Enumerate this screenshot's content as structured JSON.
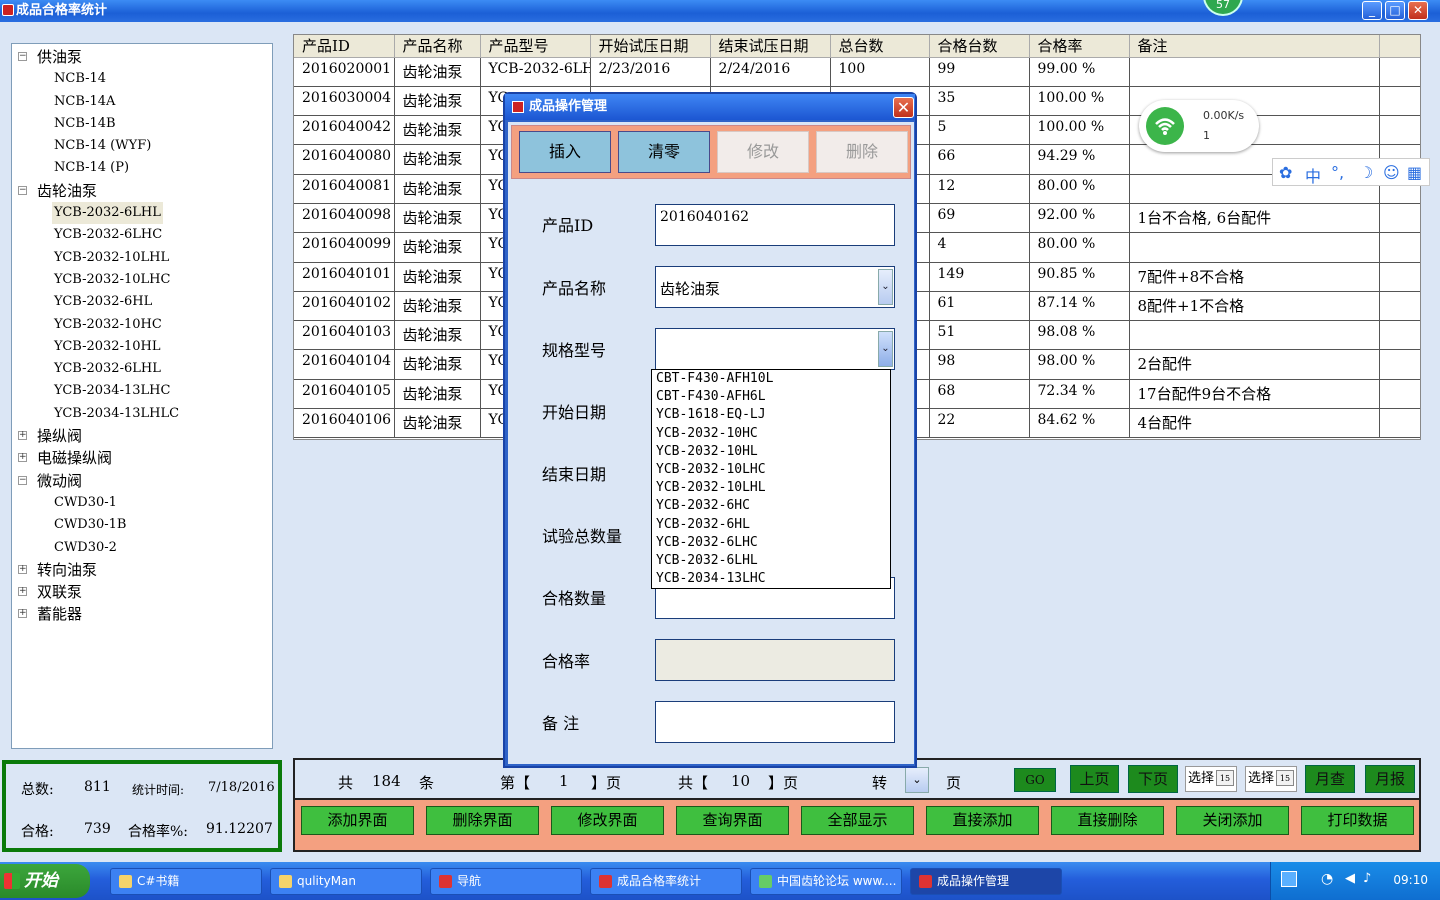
{
  "window": {
    "title": "成品合格率统计",
    "badge": "57",
    "min": "_",
    "max": "□",
    "close": "✕"
  },
  "tree": [
    {
      "label": "供油泵",
      "toggle": "−",
      "level": 0
    },
    {
      "label": "NCB-14",
      "level": 1
    },
    {
      "label": "NCB-14A",
      "level": 1
    },
    {
      "label": "NCB-14B",
      "level": 1
    },
    {
      "label": "NCB-14 (WYF)",
      "level": 1
    },
    {
      "label": "NCB-14 (P)",
      "level": 1
    },
    {
      "label": "齿轮油泵",
      "toggle": "−",
      "level": 0
    },
    {
      "label": "YCB-2032-6LHL",
      "level": 1,
      "selected": true
    },
    {
      "label": "YCB-2032-6LHC",
      "level": 1
    },
    {
      "label": "YCB-2032-10LHL",
      "level": 1
    },
    {
      "label": "YCB-2032-10LHC",
      "level": 1
    },
    {
      "label": "YCB-2032-6HL",
      "level": 1
    },
    {
      "label": "YCB-2032-10HC",
      "level": 1
    },
    {
      "label": "YCB-2032-10HL",
      "level": 1
    },
    {
      "label": "YCB-2032-6LHL",
      "level": 1
    },
    {
      "label": "YCB-2034-13LHC",
      "level": 1
    },
    {
      "label": "YCB-2034-13LHLC",
      "level": 1
    },
    {
      "label": "操纵阀",
      "toggle": "+",
      "level": 0
    },
    {
      "label": "电磁操纵阀",
      "toggle": "+",
      "level": 0
    },
    {
      "label": "微动阀",
      "toggle": "−",
      "level": 0
    },
    {
      "label": "CWD30-1",
      "level": 1
    },
    {
      "label": "CWD30-1B",
      "level": 1
    },
    {
      "label": "CWD30-2",
      "level": 1
    },
    {
      "label": "转向油泵",
      "toggle": "+",
      "level": 0
    },
    {
      "label": "双联泵",
      "toggle": "+",
      "level": 0
    },
    {
      "label": "蓄能器",
      "toggle": "+",
      "level": 0
    }
  ],
  "stats": {
    "total_label": "总数:",
    "total_value": "811",
    "time_label": "统计时间:",
    "time_value": "7/18/2016",
    "pass_label": "合格:",
    "pass_value": "739",
    "rate_label": "合格率%:",
    "rate_value": "91.12207"
  },
  "grid": {
    "columns": [
      "产品ID",
      "产品名称",
      "产品型号",
      "开始试压日期",
      "结束试压日期",
      "总台数",
      "合格台数",
      "合格率",
      "备注"
    ],
    "rows": [
      [
        "2016020001",
        "齿轮油泵",
        "YCB-2032-6LHL",
        "2/23/2016",
        "2/24/2016",
        "100",
        "99",
        "99.00 %",
        ""
      ],
      [
        "2016030004",
        "齿轮油泵",
        "YC",
        "",
        "",
        "",
        "35",
        "100.00 %",
        ""
      ],
      [
        "2016040042",
        "齿轮油泵",
        "YC",
        "",
        "",
        "",
        "5",
        "100.00 %",
        ""
      ],
      [
        "2016040080",
        "齿轮油泵",
        "YC",
        "",
        "",
        "",
        "66",
        "94.29 %",
        ""
      ],
      [
        "2016040081",
        "齿轮油泵",
        "YC",
        "",
        "",
        "",
        "12",
        "80.00 %",
        ""
      ],
      [
        "2016040098",
        "齿轮油泵",
        "YC",
        "",
        "",
        "",
        "69",
        "92.00 %",
        "1台不合格, 6台配件"
      ],
      [
        "2016040099",
        "齿轮油泵",
        "YC",
        "",
        "",
        "",
        "4",
        "80.00 %",
        ""
      ],
      [
        "2016040101",
        "齿轮油泵",
        "YC",
        "",
        "",
        "",
        "149",
        "90.85 %",
        "7配件+8不合格"
      ],
      [
        "2016040102",
        "齿轮油泵",
        "YC",
        "",
        "",
        "",
        "61",
        "87.14 %",
        "8配件+1不合格"
      ],
      [
        "2016040103",
        "齿轮油泵",
        "YC",
        "",
        "",
        "",
        "51",
        "98.08 %",
        ""
      ],
      [
        "2016040104",
        "齿轮油泵",
        "YC",
        "",
        "",
        "",
        "98",
        "98.00 %",
        "2台配件"
      ],
      [
        "2016040105",
        "齿轮油泵",
        "YC",
        "",
        "",
        "",
        "68",
        "72.34 %",
        "17台配件9台不合格"
      ],
      [
        "2016040106",
        "齿轮油泵",
        "YC",
        "",
        "",
        "",
        "22",
        "84.62 %",
        "4台配件"
      ]
    ]
  },
  "pager": {
    "total_prefix": "共",
    "total_records": "184",
    "total_unit": "条",
    "page_prefix": "第【",
    "current_page": "1",
    "page_suffix": "】页",
    "pages_prefix": "共【",
    "total_pages": "10",
    "pages_suffix": "】页",
    "goto_label": "转",
    "goto_unit": "页",
    "go_btn": "GO",
    "prev_btn": "上页",
    "next_btn": "下页",
    "date1": "选择",
    "date2": "选择",
    "cal_num": "15",
    "month_query_btn": "月查",
    "month_report_btn": "月报"
  },
  "actions": [
    "添加界面",
    "删除界面",
    "修改界面",
    "查询界面",
    "全部显示",
    "直接添加",
    "直接删除",
    "关闭添加",
    "打印数据"
  ],
  "dialog": {
    "title": "成品操作管理",
    "close": "✕",
    "buttons": {
      "insert": "插入",
      "clear": "清零",
      "modify": "修改",
      "delete": "删除"
    },
    "fields": {
      "product_id_label": "产品ID",
      "product_id_value": "2016040162",
      "product_name_label": "产品名称",
      "product_name_value": "齿轮油泵",
      "spec_label": "规格型号",
      "spec_value": "",
      "start_label": "开始日期",
      "end_label": "结束日期",
      "total_label": "试验总数量",
      "pass_label": "合格数量",
      "rate_label": "合格率",
      "note_label": "备 注"
    },
    "dropdown_arrow": "⌄",
    "dropdown_options": [
      "CBT-F430-AFH10L",
      "CBT-F430-AFH6L",
      "YCB-1618-EQ-LJ",
      "YCB-2032-10HC",
      "YCB-2032-10HL",
      "YCB-2032-10LHC",
      "YCB-2032-10LHL",
      "YCB-2032-6HC",
      "YCB-2032-6HL",
      "YCB-2032-6LHC",
      "YCB-2032-6LHL",
      "YCB-2034-13LHC"
    ]
  },
  "wifi": {
    "speed": "0.00K/s",
    "count": "1"
  },
  "ime": {
    "chinese": "中",
    "punct": "°,",
    "moon": "☽",
    "user": "☺",
    "grid": "▦",
    "paw": "✿"
  },
  "taskbar": {
    "start": "开始",
    "tasks": [
      {
        "label": "C#书籍",
        "icon_color": "#f5d36b"
      },
      {
        "label": "qulityMan",
        "icon_color": "#f5d36b"
      },
      {
        "label": "导航",
        "icon_color": "#d33"
      },
      {
        "label": "成品合格率统计",
        "icon_color": "#d33"
      },
      {
        "label": "中国齿轮论坛 www....",
        "icon_color": "#6c6"
      },
      {
        "label": "成品操作管理",
        "icon_color": "#d33"
      }
    ],
    "clock": "09:10"
  },
  "colors": {
    "accent_green": "#1d8a1d",
    "action_bg": "#f4a080",
    "panel_bg": "#dbe6f5",
    "title_blue": "#2560d8"
  }
}
